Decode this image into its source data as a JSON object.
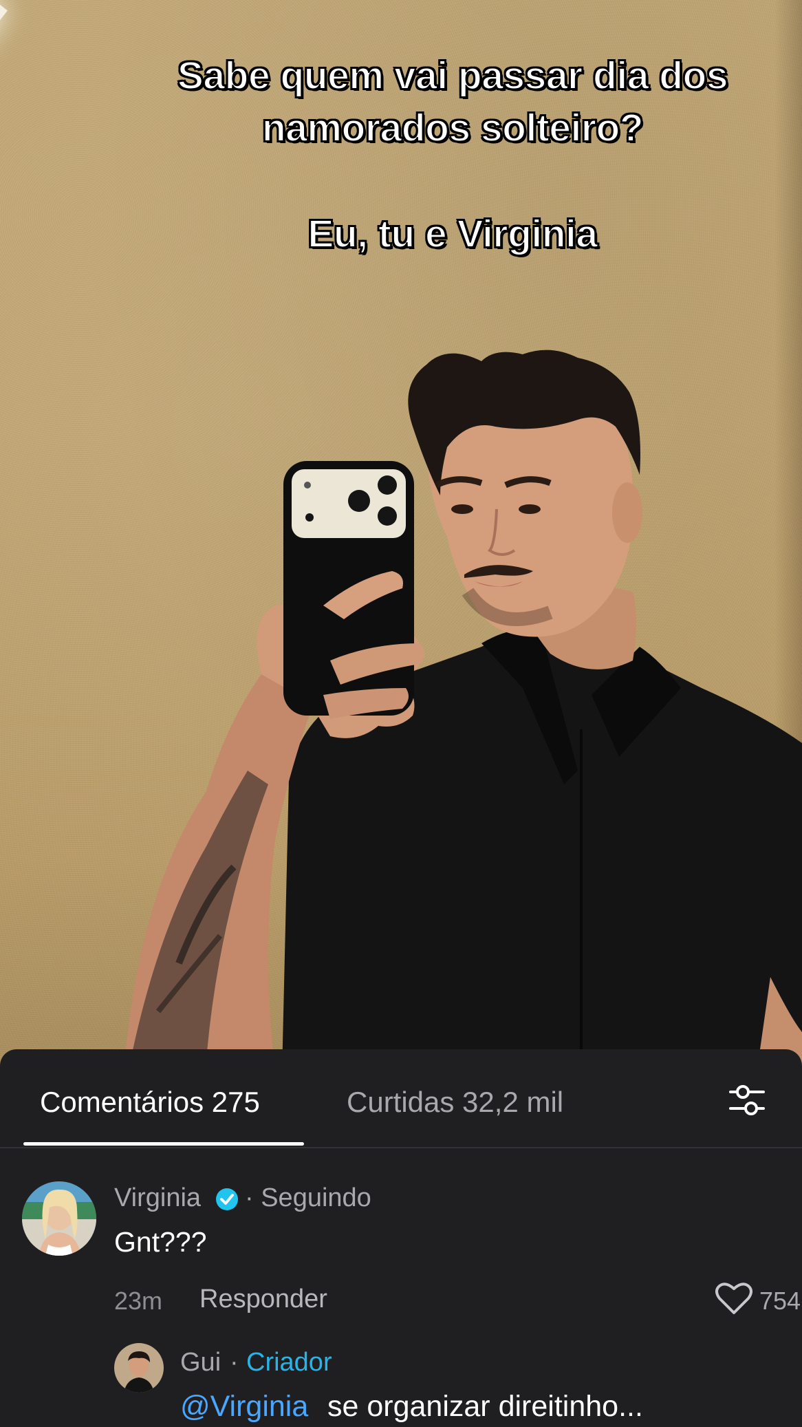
{
  "video": {
    "overlay_line1": "Sabe quem vai passar dia dos",
    "overlay_line2": "namorados solteiro?",
    "overlay_line3": "Eu, tu e Virginia"
  },
  "tabs": {
    "comments_label": "Comentários 275",
    "likes_label": "Curtidas 32,2 mil"
  },
  "comments": [
    {
      "name": "Virginia",
      "following": "· Seguindo",
      "text": "Gnt???",
      "time": "23m",
      "reply_label": "Responder",
      "likes": "754"
    },
    {
      "name": "Gui",
      "separator": "·",
      "badge": "Criador",
      "mention": "@Virginia",
      "text": "se organizar direitinho..."
    }
  ],
  "icons": {
    "filter": "sliders-icon",
    "verified": "verified-badge-icon",
    "like": "heart-icon"
  },
  "colors": {
    "panel_bg": "#1f1f21",
    "accent_blue": "#29b3e6",
    "mention_blue": "#4aa7ff",
    "wall": "#c1a673"
  }
}
